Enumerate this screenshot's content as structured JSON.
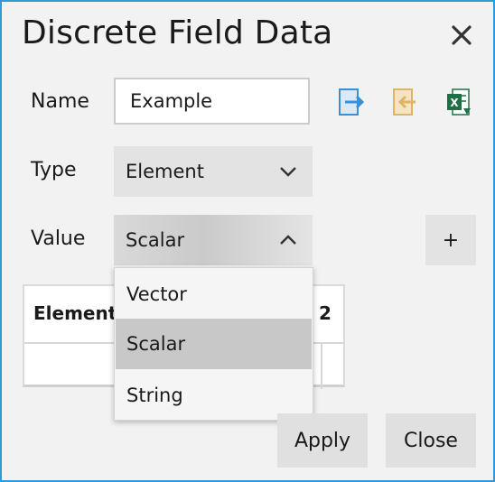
{
  "dialog": {
    "title": "Discrete Field Data",
    "close_icon": "close-x-icon"
  },
  "form": {
    "name_label": "Name",
    "name_value": "Example",
    "type_label": "Type",
    "type_selected": "Element",
    "value_label": "Value",
    "value_selected": "Scalar"
  },
  "toolbar": {
    "icons": [
      "import-icon",
      "export-icon",
      "excel-icon"
    ]
  },
  "add_button_label": "+",
  "grid": {
    "columns": [
      "Element",
      "2"
    ]
  },
  "value_dropdown": {
    "options": [
      "Vector",
      "Scalar",
      "String"
    ],
    "selected": "Scalar"
  },
  "buttons": {
    "apply_label": "Apply",
    "close_label": "Close"
  },
  "colors": {
    "accent_border": "#2e9bd7",
    "import_blue": "#3a8fd6",
    "export_tan": "#e0b36a",
    "excel_green": "#1e7145"
  }
}
